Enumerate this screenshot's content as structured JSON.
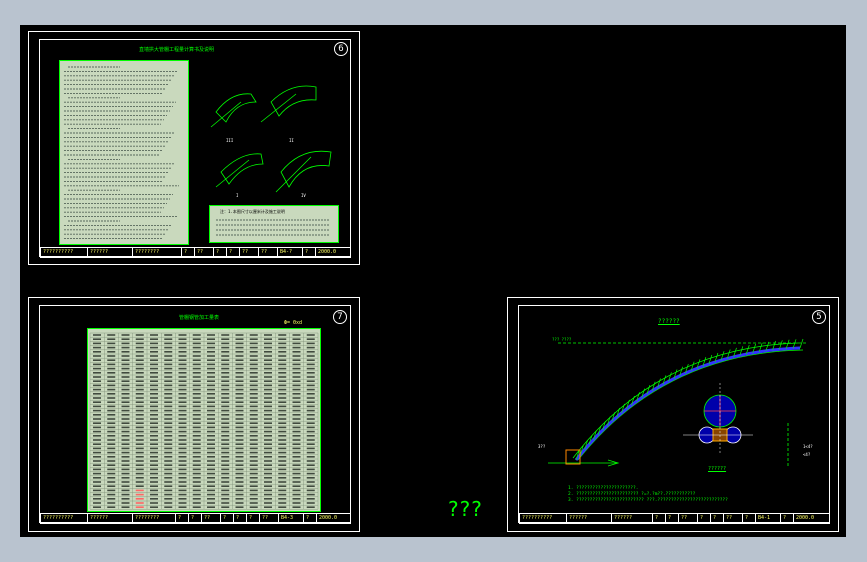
{
  "sheets": [
    {
      "id": "sheet-6",
      "number": "6",
      "title": "直墙拱大管棚工程量计算书及说明",
      "box_title": "注：1.本图尺寸以厘米计及施工说明",
      "title_block": [
        "??????????",
        "??????",
        "????????",
        "?",
        "??",
        "?",
        "?",
        "??",
        "??",
        "B4-?",
        "?",
        "2000.0"
      ]
    },
    {
      "id": "sheet-7",
      "number": "7",
      "title": "管棚钢管加工量表",
      "corner_label": "Ф= 0xd",
      "title_block": [
        "??????????",
        "??????",
        "????????",
        "?",
        "?",
        "??",
        "?",
        "?",
        "?",
        "??",
        "B4-3",
        "?",
        "2000.0"
      ]
    },
    {
      "id": "sheet-5",
      "number": "5",
      "plan_label": "??????",
      "detail_label": "??????",
      "notes": [
        "1. ??????????????????????.",
        "2. ???????????????????????      ?=?.?m??.???????????",
        "3. ????????????????????????? ???.??????????????????????????"
      ],
      "title_block": [
        "??????????",
        "??????",
        "??????",
        "?",
        "?",
        "??",
        "?",
        "?",
        "??",
        "?",
        "B4-1",
        "?",
        "2000.0"
      ]
    }
  ],
  "footer_text": "???",
  "colors": {
    "bg": "#b9c3cf",
    "canvas": "#000000",
    "cad_green": "#00ff00",
    "cad_yellow": "#ffff66",
    "pane": "#c9d9bd"
  }
}
